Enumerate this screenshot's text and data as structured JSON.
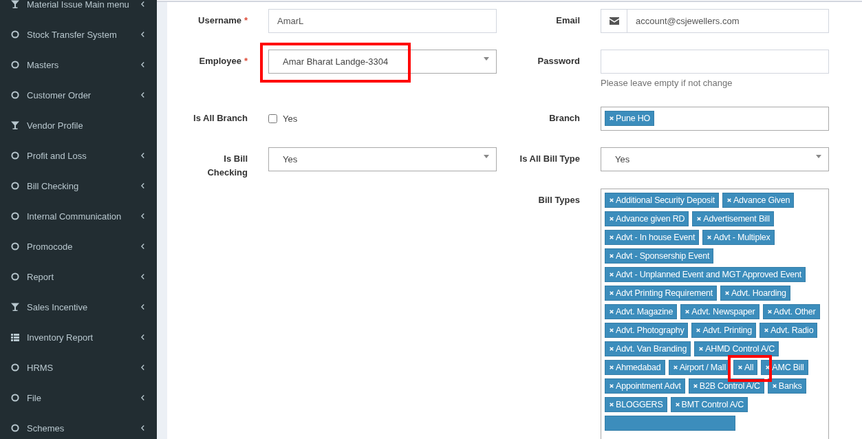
{
  "sidebar": {
    "items": [
      {
        "label": "Material Issue Main menu",
        "kind": "filter",
        "has_submenu": true
      },
      {
        "label": "Stock Transfer System",
        "kind": "circle",
        "has_submenu": true
      },
      {
        "label": "Masters",
        "kind": "circle",
        "has_submenu": true
      },
      {
        "label": "Customer Order",
        "kind": "circle",
        "has_submenu": true
      },
      {
        "label": "Vendor Profile",
        "kind": "filter",
        "has_submenu": false
      },
      {
        "label": "Profit and Loss",
        "kind": "circle",
        "has_submenu": true
      },
      {
        "label": "Bill Checking",
        "kind": "circle",
        "has_submenu": true
      },
      {
        "label": "Internal Communication",
        "kind": "circle",
        "has_submenu": true
      },
      {
        "label": "Promocode",
        "kind": "circle",
        "has_submenu": true
      },
      {
        "label": "Report",
        "kind": "circle",
        "has_submenu": true
      },
      {
        "label": "Sales Incentive",
        "kind": "filter",
        "has_submenu": true
      },
      {
        "label": "Inventory Report",
        "kind": "list",
        "has_submenu": true
      },
      {
        "label": "HRMS",
        "kind": "circle",
        "has_submenu": true
      },
      {
        "label": "File",
        "kind": "circle",
        "has_submenu": true
      },
      {
        "label": "Schemes",
        "kind": "circle",
        "has_submenu": true
      }
    ]
  },
  "form": {
    "rows": [
      {
        "left": {
          "kind": "text",
          "label": "Username",
          "required_mark": "*",
          "value": "AmarL"
        },
        "right": {
          "kind": "email",
          "label": "Email",
          "value": "account@csjewellers.com"
        }
      },
      {
        "left": {
          "kind": "select",
          "label": "Employee",
          "required_mark": "*",
          "value": "Amar Bharat Landge-3304",
          "highlighted": true
        },
        "right": {
          "kind": "password",
          "label": "Password",
          "help": "Please leave empty if not change"
        }
      },
      {
        "left": {
          "kind": "checkbox",
          "label": "Is All Branch",
          "option": "Yes",
          "checked": false
        },
        "right": {
          "kind": "tags",
          "label": "Branch",
          "tags": [
            {
              "label": "Pune HO",
              "highlighted": false
            }
          ]
        }
      },
      {
        "left": {
          "kind": "select",
          "label": "Is Bill Checking",
          "value": "Yes",
          "highlighted": false
        },
        "right": {
          "kind": "select",
          "label": "Is All Bill Type",
          "value": "Yes",
          "highlighted": false
        }
      },
      {
        "right": {
          "kind": "tags",
          "label": "Bill Types",
          "more_below": true,
          "tags": [
            {
              "label": "Additional Security Deposit",
              "highlighted": false
            },
            {
              "label": "Advance Given",
              "highlighted": false
            },
            {
              "label": "Advance given RD",
              "highlighted": false
            },
            {
              "label": "Advertisement Bill",
              "highlighted": false
            },
            {
              "label": "Advt - In house Event",
              "highlighted": false
            },
            {
              "label": "Advt - Multiplex",
              "highlighted": false
            },
            {
              "label": "Advt - Sponsership Event",
              "highlighted": false
            },
            {
              "label": "Advt - Unplanned Event and MGT Approved Event",
              "highlighted": false
            },
            {
              "label": "Advt Printing Requirement",
              "highlighted": false
            },
            {
              "label": "Advt. Hoarding",
              "highlighted": false
            },
            {
              "label": "Advt. Magazine",
              "highlighted": false
            },
            {
              "label": "Advt. Newspaper",
              "highlighted": false
            },
            {
              "label": "Advt. Other",
              "highlighted": false
            },
            {
              "label": "Advt. Photography",
              "highlighted": false
            },
            {
              "label": "Advt. Printing",
              "highlighted": false
            },
            {
              "label": "Advt. Radio",
              "highlighted": false
            },
            {
              "label": "Advt. Van Branding",
              "highlighted": false
            },
            {
              "label": "AHMD Control A/C",
              "highlighted": false
            },
            {
              "label": "Ahmedabad",
              "highlighted": false
            },
            {
              "label": "Airport / Mall",
              "highlighted": false
            },
            {
              "label": "All",
              "highlighted": true
            },
            {
              "label": "AMC Bill",
              "highlighted": false
            },
            {
              "label": "Appointment Advt",
              "highlighted": false
            },
            {
              "label": "B2B Control A/C",
              "highlighted": false
            },
            {
              "label": "Banks",
              "highlighted": false
            },
            {
              "label": "BLOGGERS",
              "highlighted": false
            },
            {
              "label": "BMT Control A/C",
              "highlighted": false
            }
          ]
        }
      }
    ]
  }
}
